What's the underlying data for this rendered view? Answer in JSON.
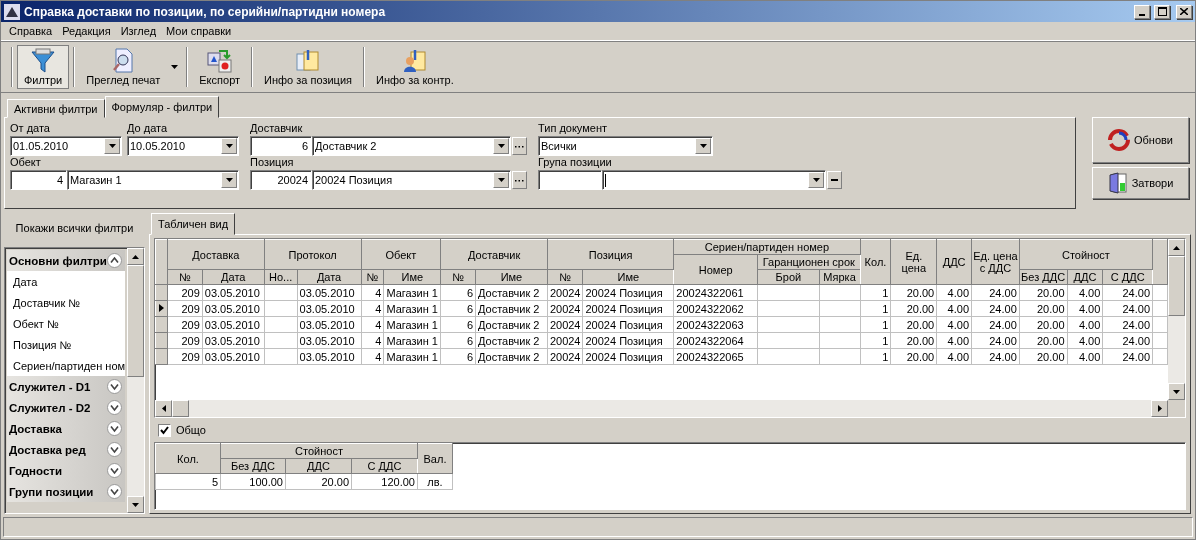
{
  "window": {
    "title": "Справка доставки по позиции, по серийни/партидни номера"
  },
  "menu": [
    "Справка",
    "Редакция",
    "Изглед",
    "Мои справки"
  ],
  "toolbar": [
    {
      "label": "Филтри",
      "kind": "filter",
      "selected": true
    },
    {
      "label": "Преглед печат",
      "kind": "preview",
      "selected": false,
      "dropdown": true
    },
    {
      "label": "Експорт",
      "kind": "export",
      "selected": false
    },
    {
      "label": "Инфо за позиция",
      "kind": "info",
      "selected": false
    },
    {
      "label": "Инфо за контр.",
      "kind": "contact",
      "selected": false
    }
  ],
  "filter_tabs": [
    {
      "label": "Активни филтри",
      "selected": false
    },
    {
      "label": "Формуляр - филтри",
      "selected": true
    }
  ],
  "form": {
    "fields": [
      {
        "label": "От дата",
        "kind": "date",
        "value": "01.05.2010"
      },
      {
        "label": "До дата",
        "kind": "date",
        "value": "10.05.2010"
      },
      {
        "label": "Доставчик",
        "kind": "lookup",
        "code": "6",
        "value": "Доставчик 2",
        "button": {
          "kind": "ellipsis"
        }
      },
      {
        "label": "Тип документ",
        "kind": "date",
        "value": "Всички"
      },
      {
        "label": "Обект",
        "kind": "lookup",
        "code": "4",
        "value": "Магазин 1"
      },
      {
        "label": "Позиция",
        "kind": "lookup",
        "code": "20024",
        "value": "20024 Позиция",
        "button": {
          "kind": "ellipsis"
        }
      },
      {
        "label": "Група позиции",
        "kind": "lookup",
        "button": {
          "kind": "clear"
        },
        "focused": true
      }
    ]
  },
  "side_buttons": [
    {
      "label": "Обнови",
      "kind": "refresh"
    },
    {
      "label": "Затвори",
      "kind": "close"
    }
  ],
  "sidebar": {
    "button": "Покажи всички филтри",
    "groups": [
      {
        "label": "Основни филтри",
        "expanded": true,
        "children": [
          {
            "label": "Дата"
          },
          {
            "label": "Доставчик №"
          },
          {
            "label": "Обект №"
          },
          {
            "label": "Позиция №"
          },
          {
            "label": "Сериен/партиден ном"
          }
        ]
      },
      {
        "label": "Служител - D1",
        "expanded": false
      },
      {
        "label": "Служител - D2",
        "expanded": false
      },
      {
        "label": "Доставка",
        "expanded": false
      },
      {
        "label": "Доставка ред",
        "expanded": false
      },
      {
        "label": "Годности",
        "expanded": false
      },
      {
        "label": "Групи позиции",
        "expanded": false
      }
    ]
  },
  "view_tabs": [
    {
      "label": "Табличен вид",
      "selected": true
    }
  ],
  "table": {
    "columns": [
      {
        "label": "Доставка",
        "colspan": 2,
        "children": [
          {
            "label": "№",
            "kind": "number"
          },
          {
            "label": "Дата",
            "kind": "text"
          }
        ]
      },
      {
        "label": "Протокол",
        "colspan": 2,
        "children": [
          {
            "label": "Но..."
          },
          {
            "label": "Дата",
            "kind": "text"
          }
        ]
      },
      {
        "label": "Обект",
        "colspan": 2,
        "children": [
          {
            "label": "№",
            "kind": "number"
          },
          {
            "label": "Име",
            "kind": "text"
          }
        ]
      },
      {
        "label": "Доставчик",
        "colspan": 2,
        "children": [
          {
            "label": "№",
            "kind": "number"
          },
          {
            "label": "Име",
            "kind": "text"
          }
        ]
      },
      {
        "label": "Позиция",
        "colspan": 2,
        "children": [
          {
            "label": "№",
            "kind": "number"
          },
          {
            "label": "Име",
            "kind": "text"
          }
        ]
      },
      {
        "label": "Сериен/партиден номер",
        "colspan": 3,
        "children": [
          {
            "label": "Номер",
            "kind": "text"
          },
          {
            "label": "Гаранционен срок",
            "colspan": 2,
            "children": [
              {
                "label": "Брой"
              },
              {
                "label": "Мярка"
              }
            ]
          }
        ]
      },
      {
        "label": "Кол.",
        "kind": "number"
      },
      {
        "label": "Ед. цена",
        "kind": "number"
      },
      {
        "label": "ДДС",
        "kind": "number"
      },
      {
        "label": "Ед. цена с ДДС",
        "kind": "number"
      },
      {
        "label": "Стойност",
        "colspan": 3,
        "children": [
          {
            "label": "Без ДДС",
            "kind": "number"
          },
          {
            "label": "ДДС",
            "kind": "number"
          },
          {
            "label": "С ДДС",
            "kind": "number"
          }
        ]
      }
    ],
    "rows": [
      {
        "selected": false,
        "cells": [
          "209",
          "03.05.2010",
          null,
          "03.05.2010",
          "4",
          "Магазин 1",
          "6",
          "Доставчик 2",
          "20024",
          "20024 Позиция",
          "20024322061",
          null,
          null,
          "1",
          "20.00",
          "4.00",
          "24.00",
          "20.00",
          "4.00",
          "24.00"
        ]
      },
      {
        "selected": true,
        "cells": [
          "209",
          "03.05.2010",
          null,
          "03.05.2010",
          "4",
          "Магазин 1",
          "6",
          "Доставчик 2",
          "20024",
          "20024 Позиция",
          "20024322062",
          null,
          null,
          "1",
          "20.00",
          "4.00",
          "24.00",
          "20.00",
          "4.00",
          "24.00"
        ]
      },
      {
        "selected": false,
        "cells": [
          "209",
          "03.05.2010",
          null,
          "03.05.2010",
          "4",
          "Магазин 1",
          "6",
          "Доставчик 2",
          "20024",
          "20024 Позиция",
          "20024322063",
          null,
          null,
          "1",
          "20.00",
          "4.00",
          "24.00",
          "20.00",
          "4.00",
          "24.00"
        ]
      },
      {
        "selected": false,
        "cells": [
          "209",
          "03.05.2010",
          null,
          "03.05.2010",
          "4",
          "Магазин 1",
          "6",
          "Доставчик 2",
          "20024",
          "20024 Позиция",
          "20024322064",
          null,
          null,
          "1",
          "20.00",
          "4.00",
          "24.00",
          "20.00",
          "4.00",
          "24.00"
        ]
      },
      {
        "selected": false,
        "cells": [
          "209",
          "03.05.2010",
          null,
          "03.05.2010",
          "4",
          "Магазин 1",
          "6",
          "Доставчик 2",
          "20024",
          "20024 Позиция",
          "20024322065",
          null,
          null,
          "1",
          "20.00",
          "4.00",
          "24.00",
          "20.00",
          "4.00",
          "24.00"
        ]
      }
    ]
  },
  "totals": {
    "checkbox": {
      "label": "Общо",
      "checked": true
    },
    "columns": [
      {
        "label": "Кол.",
        "kind": "number"
      },
      {
        "label": "Стойност",
        "colspan": 3,
        "children": [
          {
            "label": "Без ДДС",
            "kind": "number"
          },
          {
            "label": "ДДС",
            "kind": "number"
          },
          {
            "label": "С ДДС",
            "kind": "number"
          }
        ]
      },
      {
        "label": "Вал.",
        "kind": "center"
      }
    ],
    "rows": [
      {
        "cells": [
          "5",
          "100.00",
          "20.00",
          "120.00",
          "лв."
        ]
      }
    ]
  }
}
